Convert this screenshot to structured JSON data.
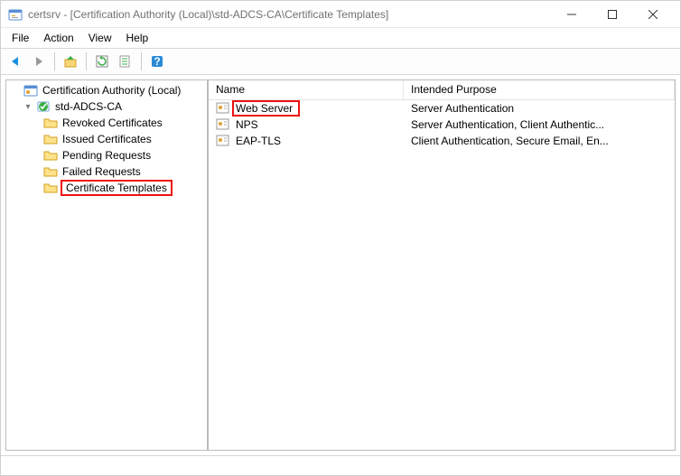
{
  "titlebar": {
    "text": "certsrv - [Certification Authority (Local)\\std-ADCS-CA\\Certificate Templates]"
  },
  "menu": {
    "file": "File",
    "action": "Action",
    "view": "View",
    "help": "Help"
  },
  "tree": {
    "root": "Certification Authority (Local)",
    "ca": "std-ADCS-CA",
    "items": [
      "Revoked Certificates",
      "Issued Certificates",
      "Pending Requests",
      "Failed Requests",
      "Certificate Templates"
    ]
  },
  "list": {
    "headers": {
      "name": "Name",
      "purpose": "Intended Purpose"
    },
    "rows": [
      {
        "name": "Web Server",
        "purpose": "Server Authentication"
      },
      {
        "name": "NPS",
        "purpose": "Server Authentication, Client Authentic..."
      },
      {
        "name": "EAP-TLS",
        "purpose": "Client Authentication, Secure Email, En..."
      }
    ]
  }
}
